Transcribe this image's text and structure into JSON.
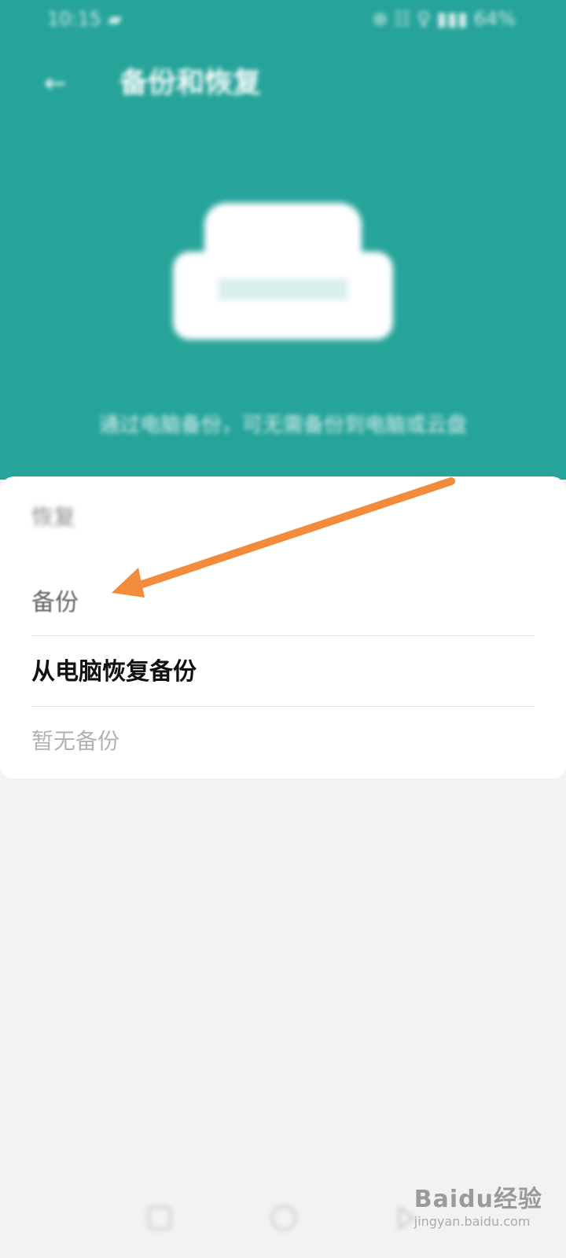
{
  "status_bar": {
    "time": "10:15 ▰",
    "indicators": "⊕ ☷ ♀ ▮▮▮ 64%"
  },
  "app_bar": {
    "back_icon": "←",
    "title": "备份和恢复"
  },
  "header": {
    "icon": "sofa-icon",
    "description": "通过电脑备份，可无需备份到电脑或云盘"
  },
  "section": {
    "label": "恢复"
  },
  "menu": {
    "backup_label": "备份",
    "restore_from_pc_label": "从电脑恢复备份",
    "empty_label": "暂无备份"
  },
  "annotation": {
    "arrow_color": "#f28b3c"
  },
  "nav_bar": {
    "buttons": [
      "back-icon",
      "home-icon",
      "recent-apps-icon"
    ]
  },
  "watermark": {
    "main": "Baidu经验",
    "sub": "jingyan.baidu.com"
  },
  "colors": {
    "header": "#26a49a",
    "page_background": "#f2f2f2",
    "card": "#ffffff"
  }
}
